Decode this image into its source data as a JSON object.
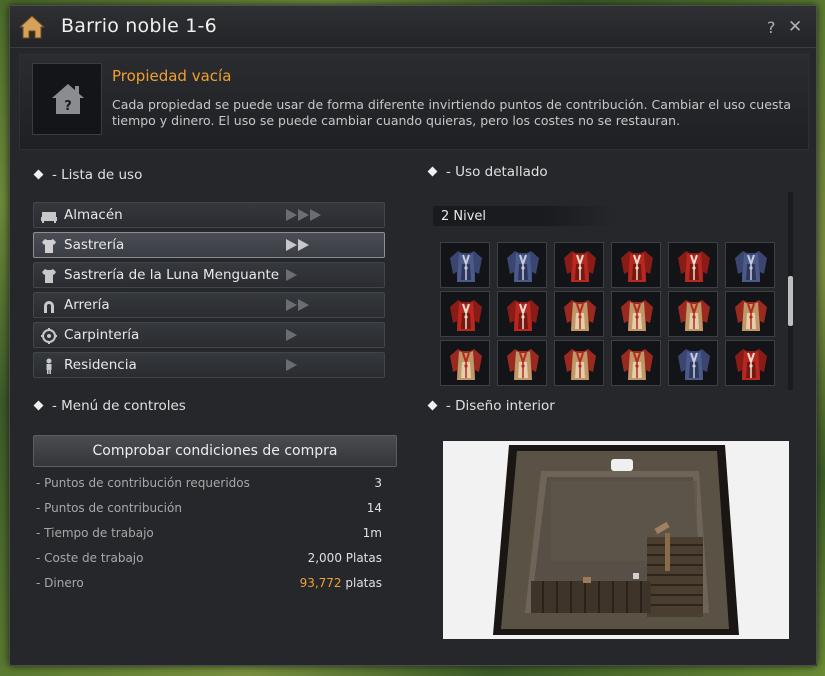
{
  "window": {
    "title": "Barrio noble 1-6",
    "help_label": "?",
    "close_label": "✕",
    "home_icon": "house-icon"
  },
  "property": {
    "title": "Propiedad vacía",
    "description": "Cada propiedad se puede usar de forma diferente invirtiendo puntos de contribución. Cambiar el uso cuesta tiempo y dinero. El uso se puede cambiar cuando quieras, pero los costes no se restauran.",
    "icon": "house-question-icon"
  },
  "use_list": {
    "title": "- Lista de uso",
    "items": [
      {
        "label": "Almacén",
        "icon": "storage-bed-icon",
        "arrows": 3,
        "selected": false
      },
      {
        "label": "Sastrería",
        "icon": "shirt-icon",
        "arrows": 2,
        "selected": true
      },
      {
        "label": "Sastrería de la Luna Menguante",
        "icon": "shirt-icon",
        "arrows": 1,
        "selected": false
      },
      {
        "label": "Arrería",
        "icon": "horseshoe-icon",
        "arrows": 2,
        "selected": false
      },
      {
        "label": "Carpintería",
        "icon": "gear-icon",
        "arrows": 1,
        "selected": false
      },
      {
        "label": "Residencia",
        "icon": "person-icon",
        "arrows": 1,
        "selected": false
      }
    ]
  },
  "controls": {
    "title": "- Menú de controles",
    "buy_button": "Comprobar condiciones de compra",
    "stats": [
      {
        "label": "- Puntos de contribución requeridos",
        "value": "3"
      },
      {
        "label": "- Puntos de contribución",
        "value": "14"
      },
      {
        "label": "- Tiempo de trabajo",
        "value": "1m"
      },
      {
        "label": "- Coste de trabajo",
        "value": "2,000 Platas"
      },
      {
        "label": "- Dinero",
        "value_gold": "93,772",
        "value_suffix": " platas"
      }
    ]
  },
  "detail": {
    "title": "- Uso detallado",
    "level": "2 Nivel",
    "items": [
      "blue",
      "blue",
      "red",
      "red",
      "red",
      "blue",
      "red",
      "red",
      "redtan",
      "redtan",
      "redtan",
      "redtan",
      "redtan",
      "redtan",
      "redtan",
      "redtan",
      "blue",
      "red"
    ]
  },
  "interior": {
    "title": "- Diseño interior"
  },
  "colors": {
    "accent_orange": "#f0a030",
    "panel_bg": "#25272b",
    "selected_border": "#8a8d94"
  }
}
